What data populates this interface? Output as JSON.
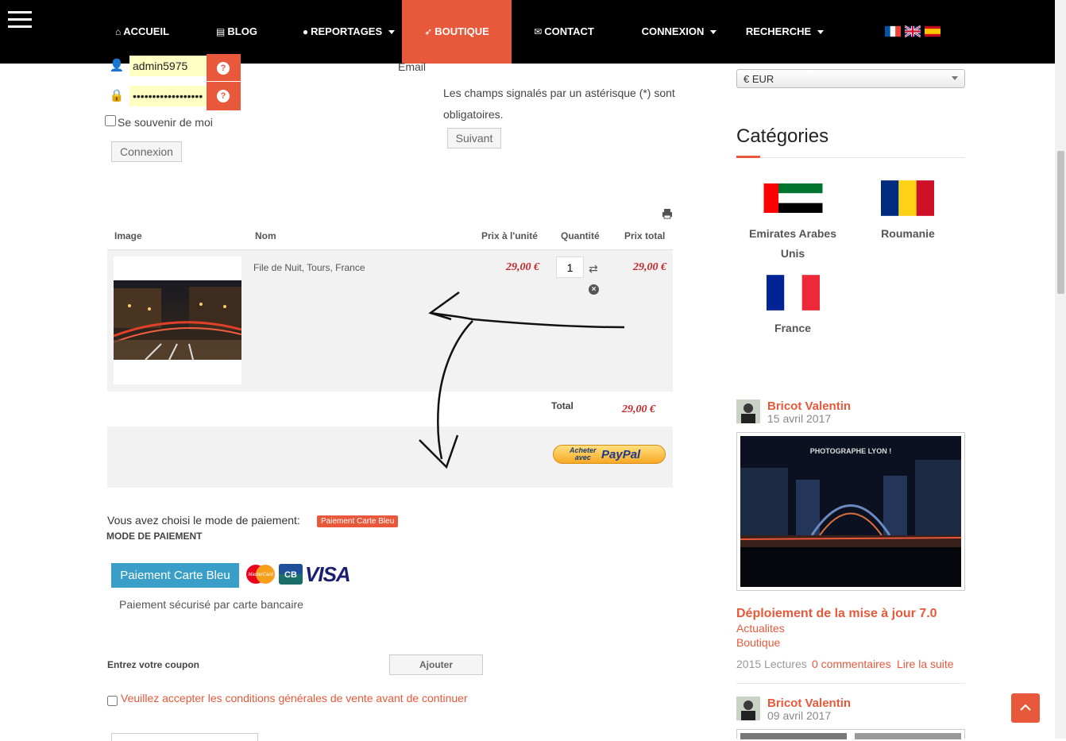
{
  "nav": {
    "items": [
      {
        "label": "ACCUEIL",
        "icon": "home-icon"
      },
      {
        "label": "BLOG",
        "icon": "newspaper-icon"
      },
      {
        "label": "REPORTAGES",
        "icon": "globe-icon"
      },
      {
        "label": "BOUTIQUE",
        "icon": "rocket-icon"
      },
      {
        "label": "CONTACT",
        "icon": "envelope-icon"
      },
      {
        "label": "CONNEXION"
      },
      {
        "label": "RECHERCHE"
      }
    ],
    "languages": [
      "flag-france-icon",
      "flag-uk-icon",
      "flag-spain-icon"
    ],
    "active_color": "#e8583b"
  },
  "login": {
    "username": "admin5975",
    "password": "••••••••••••••••••",
    "remember_label": "Se souvenir de moi",
    "submit_label": "Connexion"
  },
  "register": {
    "email_label": "Email",
    "required_note": "Les champs signalés par un astérisque (*) sont obligatoires.",
    "next_label": "Suivant"
  },
  "cart": {
    "headers": {
      "image": "Image",
      "name": "Nom",
      "unit_price": "Prix à l'unité",
      "quantity": "Quantité",
      "total_price": "Prix total"
    },
    "items": [
      {
        "name": "File de Nuit, Tours, France",
        "unit_price": "29,00 €",
        "quantity": "1",
        "total_price": "29,00 €"
      }
    ],
    "total_label": "Total",
    "total_value": "29,00 €",
    "paypal": {
      "line1": "Acheter",
      "line2": "avec",
      "brand": "PayPal"
    }
  },
  "payment": {
    "chosen_label": "Vous avez choisi le mode de paiement:",
    "chosen_badge": "Paiement Carte Bleu",
    "section_title": "MODE DE PAIEMENT",
    "method_button": "Paiement Carte Bleu",
    "cards": [
      "MasterCard",
      "CB",
      "VISA"
    ],
    "secure_note": "Paiement sécurisé par carte bancaire",
    "coupon_label": "Entrez votre coupon",
    "coupon_button": "Ajouter",
    "terms_label": "Veuillez accepter les conditions générales de vente avant de continuer"
  },
  "sidebar": {
    "currency": "€ EUR",
    "categories_title": "Catégories",
    "categories": [
      {
        "name": "Emirates Arabes Unis"
      },
      {
        "name": "Roumanie"
      },
      {
        "name": "France"
      }
    ],
    "posts": [
      {
        "author": "Bricot Valentin",
        "date": "15 avril 2017",
        "image_caption": "PHOTOGRAPHE LYON !",
        "title": "Déploiement de la mise à jour 7.0",
        "tags": [
          "Actualites",
          "Boutique"
        ],
        "reads": "2015 Lectures",
        "comments": "0 commentaires",
        "read_more": "Lire la suite"
      },
      {
        "author": "Bricot Valentin",
        "date": "09 avril 2017"
      }
    ]
  }
}
